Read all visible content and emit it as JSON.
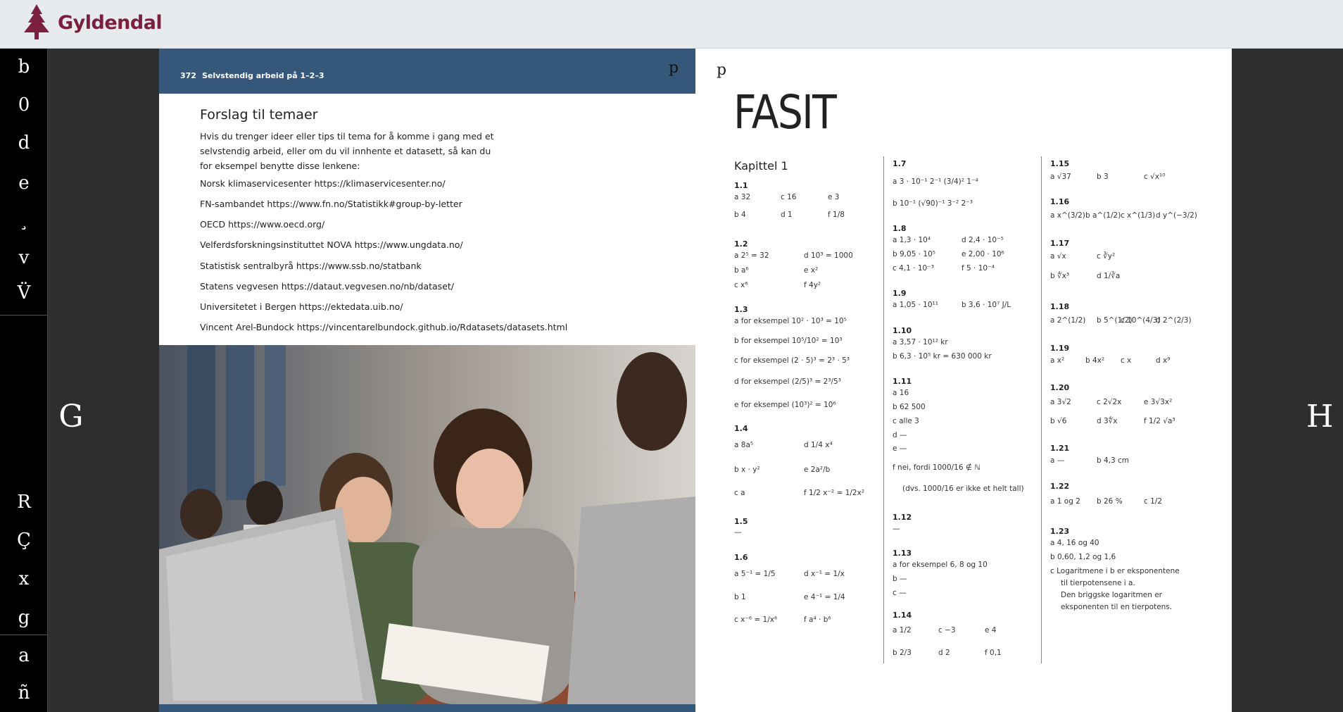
{
  "header": {
    "brand": "Gyldendal",
    "logo_icon": "tree-icon"
  },
  "sidebar": {
    "buttons": [
      "b",
      "0",
      "d",
      "e",
      "¸",
      "v",
      "V̈",
      "R",
      "Ç",
      "x",
      "g",
      "a",
      "ñ"
    ]
  },
  "nav": {
    "prev": "G",
    "next": "H"
  },
  "left_page": {
    "page_number": "372",
    "running_head": "Selvstendig arbeid på 1–2–3",
    "corner_glyph": "p",
    "title": "Forslag til temaer",
    "intro": "Hvis du trenger ideer eller tips til tema for å komme i gang med et selvstendig arbeid, eller om du vil innhente et datasett, så kan du for eksempel benytte disse lenkene:",
    "links": [
      "Norsk klimaservicesenter https://klimaservicesenter.no/",
      "FN-sambandet https://www.fn.no/Statistikk#group-by-letter",
      "OECD   https://www.oecd.org/",
      "Velferdsforskningsinstituttet NOVA https://www.ungdata.no/",
      "Statistisk sentralbyrå https://www.ssb.no/statbank",
      "Statens vegvesen https://dataut.vegvesen.no/nb/dataset/",
      "Universitetet i Bergen https://ektedata.uib.no/",
      "Vincent Arel-Bundock https://vincentarelbundock.github.io/Rdatasets/datasets.html"
    ]
  },
  "right_page": {
    "corner_glyph": "p",
    "title": "FASIT",
    "chapter": "Kapittel 1",
    "col1": [
      {
        "num": "1.1",
        "rows": [
          "a  32",
          "c  16",
          "e  3",
          "b  4",
          "d  1",
          "f  1/8"
        ]
      },
      {
        "num": "1.2",
        "rows": [
          "a  2⁵ = 32",
          "d  10³ = 1000",
          "b  a⁶",
          "e  x²",
          "c  x⁶",
          "f  4y²"
        ]
      },
      {
        "num": "1.3",
        "rows": [
          "a  for eksempel 10² · 10³ = 10⁵",
          "b  for eksempel 10⁵/10² = 10³",
          "c  for eksempel (2 · 5)³ = 2³ · 5³",
          "d  for eksempel (2/5)³ = 2³/5³",
          "e  for eksempel (10³)² = 10⁶"
        ]
      },
      {
        "num": "1.4",
        "rows": [
          "a  8a⁵",
          "d  1/4 x⁴",
          "b  x · y²",
          "e  2a²/b",
          "c  a",
          "f  1/2 x⁻² = 1/2x²"
        ]
      },
      {
        "num": "1.5",
        "rows": [
          "—"
        ]
      },
      {
        "num": "1.6",
        "rows": [
          "a  5⁻¹ = 1/5",
          "d  x⁻¹ = 1/x",
          "b  1",
          "e  4⁻¹ = 1/4",
          "c  x⁻⁶ = 1/x⁶",
          "f  a⁴ · b⁶"
        ]
      }
    ],
    "col2": [
      {
        "num": "1.7",
        "rows": [
          "a  3 · 10⁻¹    2⁻¹    (3/4)²    1⁻⁴",
          "b  10⁻¹    (√90)⁻¹    3⁻²    2⁻³"
        ]
      },
      {
        "num": "1.8",
        "rows": [
          "a  1,3 · 10⁴",
          "d  2,4 · 10⁻⁵",
          "b  9,05 · 10⁵",
          "e  2,00 · 10⁶",
          "c  4,1 · 10⁻³",
          "f  5 · 10⁻⁴"
        ]
      },
      {
        "num": "1.9",
        "rows": [
          "a  1,05 · 10¹¹",
          "b  3,6 · 10⁷ J/L"
        ]
      },
      {
        "num": "1.10",
        "rows": [
          "a  3,57 · 10¹² kr",
          "b  6,3 · 10⁵ kr = 630 000 kr"
        ]
      },
      {
        "num": "1.11",
        "rows": [
          "a  16",
          "b  62 500",
          "c  alle 3",
          "d  —",
          "e  —",
          "f  nei, fordi 1000/16 ∉ ℕ",
          "(dvs. 1000/16 er ikke et helt tall)"
        ]
      },
      {
        "num": "1.12",
        "rows": [
          "—"
        ]
      },
      {
        "num": "1.13",
        "rows": [
          "a  for eksempel 6, 8 og 10",
          "b  —",
          "c  —"
        ]
      },
      {
        "num": "1.14",
        "rows": [
          "a  1/2",
          "c  −3",
          "e  4",
          "b  2/3",
          "d  2",
          "f  0,1"
        ]
      }
    ],
    "col3": [
      {
        "num": "1.15",
        "rows": [
          "a  √37",
          "b  3",
          "c  √x¹⁰"
        ]
      },
      {
        "num": "1.16",
        "rows": [
          "a  x^(3/2)",
          "b  a^(1/2)",
          "c  x^(1/3)",
          "d  y^(−3/2)"
        ]
      },
      {
        "num": "1.17",
        "rows": [
          "a  √x",
          "c  ∛y²",
          "b  ∜x³",
          "d  1/∛a"
        ]
      },
      {
        "num": "1.18",
        "rows": [
          "a  2^(1/2)",
          "b  5^(1/2)",
          "c  10^(4/3)",
          "d  2^(2/3)"
        ]
      },
      {
        "num": "1.19",
        "rows": [
          "a  x²",
          "b  4x²",
          "c  x",
          "d  x⁹"
        ]
      },
      {
        "num": "1.20",
        "rows": [
          "a  3√2",
          "c  2√2x",
          "e  3√3x²",
          "b  √6",
          "d  3∜x",
          "f  1/2 √a³"
        ]
      },
      {
        "num": "1.21",
        "rows": [
          "a  —",
          "b  4,3 cm"
        ]
      },
      {
        "num": "1.22",
        "rows": [
          "a  1 og 2",
          "b  26 %",
          "c  1/2"
        ]
      },
      {
        "num": "1.23",
        "rows": [
          "a  4, 16 og 40",
          "b  0,60, 1,2 og 1,6",
          "c  Logaritmene i b er eksponentene",
          "til tierpotensene i a.",
          "Den briggske logaritmen er",
          "eksponenten til en tierpotens."
        ]
      }
    ]
  }
}
